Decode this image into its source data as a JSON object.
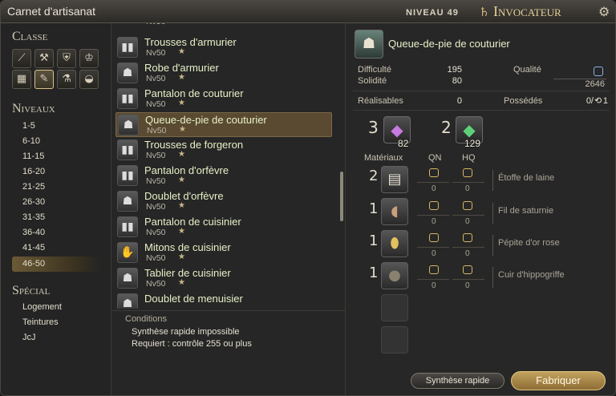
{
  "window": {
    "title": "Carnet d'artisanat",
    "level_label": "NIVEAU 49",
    "job_name": "Invocateur"
  },
  "sidebar": {
    "class_title": "Classe",
    "levels_title": "Niveaux",
    "levels": [
      "1-5",
      "6-10",
      "11-15",
      "16-20",
      "21-25",
      "26-30",
      "31-35",
      "36-40",
      "41-45",
      "46-50"
    ],
    "special_title": "Spécial",
    "special": [
      "Logement",
      "Teintures",
      "JcJ"
    ]
  },
  "recipes": [
    {
      "name": "Trousses d'armurier",
      "level": "Nv50",
      "icon": "trousers-icon"
    },
    {
      "name": "Robe d'armurier",
      "level": "Nv50",
      "icon": "robe-icon"
    },
    {
      "name": "Pantalon de couturier",
      "level": "Nv50",
      "icon": "pants-icon"
    },
    {
      "name": "Queue-de-pie de couturier",
      "level": "Nv50",
      "icon": "coat-icon"
    },
    {
      "name": "Trousses de forgeron",
      "level": "Nv50",
      "icon": "trousers-icon"
    },
    {
      "name": "Pantalon d'orfèvre",
      "level": "Nv50",
      "icon": "pants-icon"
    },
    {
      "name": "Doublet d'orfèvre",
      "level": "Nv50",
      "icon": "doublet-icon"
    },
    {
      "name": "Pantalon de cuisinier",
      "level": "Nv50",
      "icon": "pants-icon"
    },
    {
      "name": "Mitons de cuisinier",
      "level": "Nv50",
      "icon": "gloves-icon"
    },
    {
      "name": "Tablier de cuisinier",
      "level": "Nv50",
      "icon": "apron-icon"
    },
    {
      "name": "Doublet de menuisier",
      "level": "",
      "icon": "doublet-icon"
    }
  ],
  "conditions": {
    "title": "Conditions",
    "line1": "Synthèse rapide impossible",
    "line2": "Requiert : contrôle 255 ou plus"
  },
  "detail": {
    "item_name": "Queue-de-pie de couturier",
    "difficulty_label": "Difficulté",
    "difficulty_value": "195",
    "durability_label": "Solidité",
    "durability_value": "80",
    "quality_label": "Qualité",
    "quality_value": "2646",
    "craftable_label": "Réalisables",
    "craftable_value": "0",
    "owned_label": "Possédés",
    "owned_value": "0/",
    "owned_icon_value": "1",
    "crystals": [
      {
        "required": "3",
        "held": "82",
        "icon": "lightning-crystal-icon",
        "color": "#c77ae0"
      },
      {
        "required": "2",
        "held": "129",
        "icon": "wind-crystal-icon",
        "color": "#5fd07a"
      }
    ],
    "materials_label": "Matériaux",
    "nq_label": "QN",
    "hq_label": "HQ",
    "materials": [
      {
        "qty": "2",
        "name": "Étoffe de laine",
        "nq": "0",
        "hq": "0",
        "icon": "cloth-icon"
      },
      {
        "qty": "1",
        "name": "Fil de saturnie",
        "nq": "0",
        "hq": "0",
        "icon": "thread-icon"
      },
      {
        "qty": "1",
        "name": "Pépite d'or rose",
        "nq": "0",
        "hq": "0",
        "icon": "nugget-icon"
      },
      {
        "qty": "1",
        "name": "Cuir d'hippogriffe",
        "nq": "0",
        "hq": "0",
        "icon": "leather-icon"
      }
    ],
    "quick_synthesis": "Synthèse rapide",
    "craft": "Fabriquer"
  }
}
